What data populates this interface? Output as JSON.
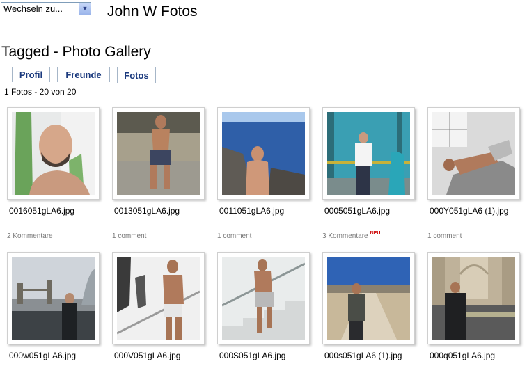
{
  "header": {
    "switch_label": "Wechseln zu...",
    "site_title": "John W Fotos"
  },
  "page_title": "Tagged - Photo Gallery",
  "tabs": [
    {
      "label": "Profil"
    },
    {
      "label": "Freunde"
    },
    {
      "label": "Fotos",
      "active": true
    }
  ],
  "photo_count": "1 Fotos - 20 von 20",
  "new_badge": "NEU",
  "photos": [
    {
      "filename": "0016051gLA6.jpg",
      "comments": "2 Kommentare"
    },
    {
      "filename": "0013051gLA6.jpg",
      "comments": "1 comment"
    },
    {
      "filename": "0011051gLA6.jpg",
      "comments": "1 comment"
    },
    {
      "filename": "0005051gLA6.jpg",
      "comments": "3 Kommentare",
      "new": true
    },
    {
      "filename": "000Y051gLA6 (1).jpg",
      "comments": "1 comment"
    },
    {
      "filename": "000w051gLA6.jpg",
      "comments": ""
    },
    {
      "filename": "000V051gLA6.jpg",
      "comments": ""
    },
    {
      "filename": "000S051gLA6.jpg",
      "comments": ""
    },
    {
      "filename": "000s051gLA6 (1).jpg",
      "comments": ""
    },
    {
      "filename": "000q051gLA6.jpg",
      "comments": ""
    }
  ]
}
